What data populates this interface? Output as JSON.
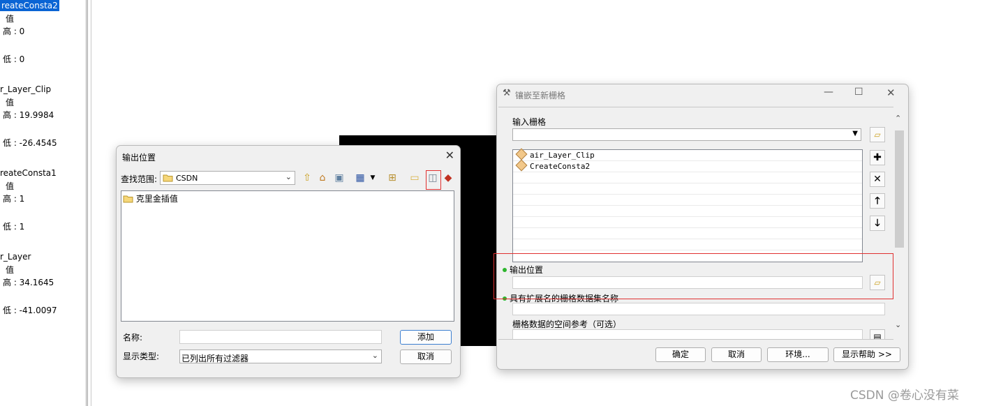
{
  "toc": {
    "items": [
      {
        "text": "reateConsta2",
        "selected": true
      },
      {
        "text": "值"
      },
      {
        "text": "高 : 0"
      },
      {
        "text": "低 : 0"
      },
      {
        "text": "r_Layer_Clip"
      },
      {
        "text": "值"
      },
      {
        "text": "高 : 19.9984"
      },
      {
        "text": "低 : -26.4545"
      },
      {
        "text": "reateConsta1"
      },
      {
        "text": "值"
      },
      {
        "text": "高 : 1"
      },
      {
        "text": "低 : 1"
      },
      {
        "text": "r_Layer"
      },
      {
        "text": "值"
      },
      {
        "text": "高 : 34.1645"
      },
      {
        "text": "低 : -41.0097"
      }
    ]
  },
  "output_dialog": {
    "title": "输出位置",
    "look_in_label": "查找范围:",
    "look_in_value": "CSDN",
    "files": [
      "克里金插值"
    ],
    "name_label": "名称:",
    "name_value": "",
    "type_label": "显示类型:",
    "type_value": "已列出所有过滤器",
    "add_button": "添加",
    "cancel_button": "取消"
  },
  "mosaic_dialog": {
    "title": "镶嵌至新栅格",
    "input_rasters_label": "输入栅格",
    "input_rasters": [
      "air_Layer_Clip",
      "CreateConsta2"
    ],
    "output_location_label": "输出位置",
    "output_location_value": "",
    "dataset_name_label": "具有扩展名的栅格数据集名称",
    "dataset_name_value": "",
    "spatial_ref_label": "栅格数据的空间参考（可选）",
    "ok_button": "确定",
    "cancel_button": "取消",
    "env_button": "环境...",
    "help_button": "显示帮助 >>"
  },
  "watermark": "CSDN @卷心没有菜"
}
